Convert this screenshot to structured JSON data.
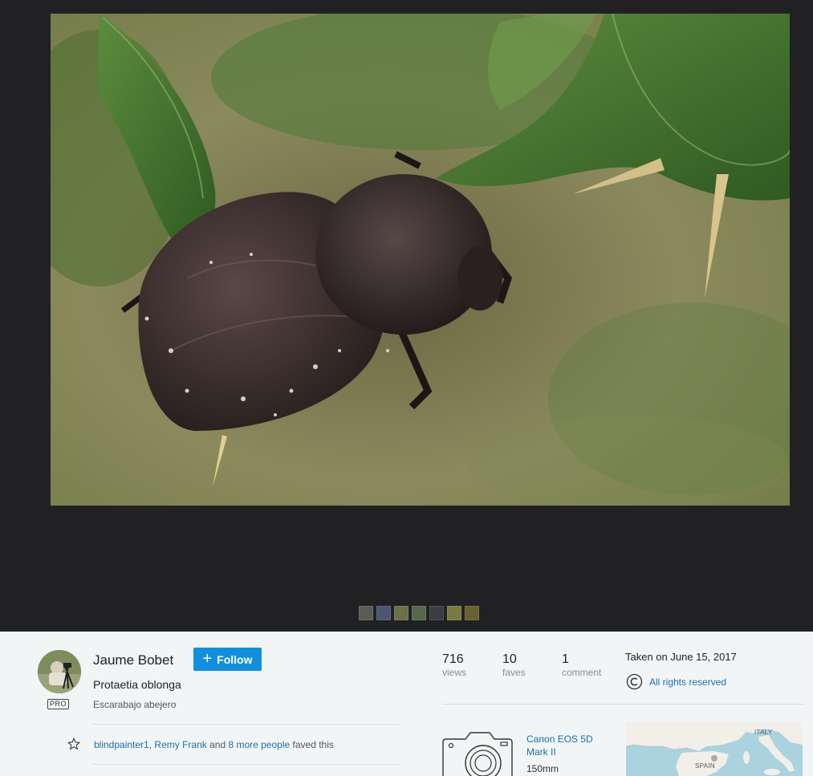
{
  "photo": {
    "subject": "beetle-on-thistle-leaf",
    "colors": {
      "background_dark": "#212124",
      "leaf": "#3f6b2b",
      "beetle": "#2e2422"
    }
  },
  "filmstrip": {
    "thumbnails": [
      "#5b5b55",
      "#4b5670",
      "#6a7048",
      "#55684a",
      "#3a3d43",
      "#7a7a40",
      "#6a5f30"
    ]
  },
  "owner": {
    "name": "Jaume Bobet",
    "badge": "PRO",
    "follow_label": "Follow"
  },
  "photo_info": {
    "title": "Protaetia oblonga",
    "description": "Escarabajo abejero"
  },
  "faves": {
    "user1": "blindpainter1",
    "separator": ",",
    "user2": "Remy Frank",
    "and_text": "and",
    "more_people": "8 more people",
    "suffix": "faved this"
  },
  "stats": {
    "views": {
      "value": "716",
      "label": "views"
    },
    "faves": {
      "value": "10",
      "label": "faves"
    },
    "comments": {
      "value": "1",
      "label": "comment"
    }
  },
  "taken": "Taken on June 15, 2017",
  "license": "All rights reserved",
  "camera": {
    "model": "Canon EOS 5D Mark II",
    "focal_length": "150mm"
  },
  "map": {
    "labels": {
      "italy": "ITALY",
      "spain": "SPAIN"
    }
  },
  "colors": {
    "follow_button": "#128fdc",
    "link": "#1a6fa8",
    "panel_bg": "#f2f5f6"
  }
}
